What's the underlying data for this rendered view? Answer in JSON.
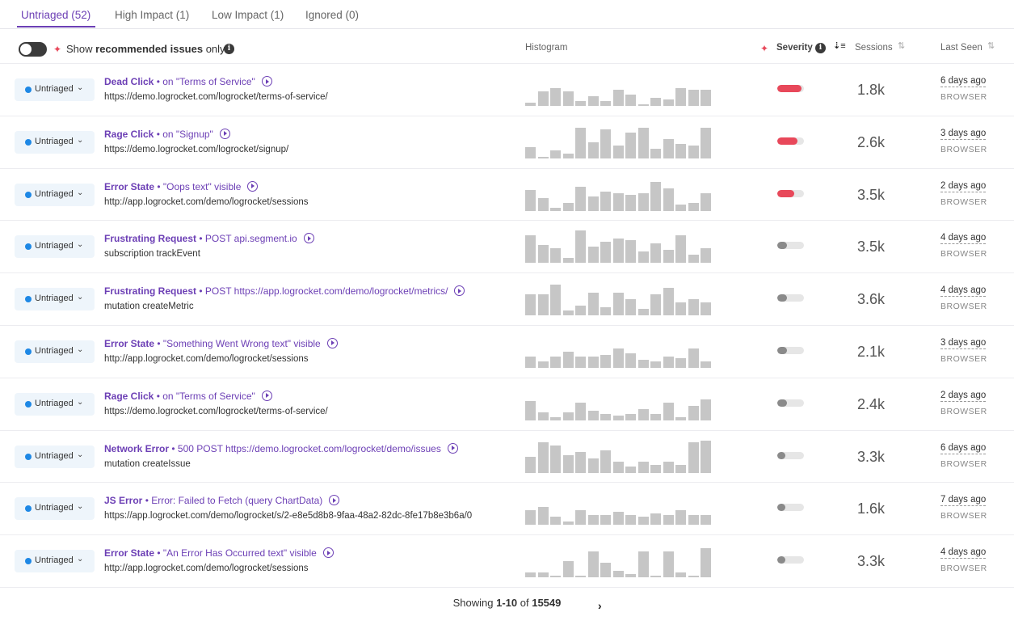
{
  "tabs": [
    {
      "label": "Untriaged (52)",
      "active": true
    },
    {
      "label": "High Impact (1)",
      "active": false
    },
    {
      "label": "Low Impact (1)",
      "active": false
    },
    {
      "label": "Ignored (0)",
      "active": false
    }
  ],
  "header": {
    "toggle_on": false,
    "rec_prefix": "Show ",
    "rec_bold": "recommended issues",
    "rec_suffix": " only",
    "info_glyph": "i",
    "col_histogram": "Histogram",
    "col_severity": "Severity",
    "col_sessions": "Sessions",
    "col_last_seen": "Last Seen"
  },
  "colors": {
    "accent": "#6c3fb5",
    "severity_high": "#e8485a",
    "severity_low": "#8a8a8a",
    "status_dot": "#1e88e5"
  },
  "rows": [
    {
      "status": "Untriaged",
      "type": "Dead Click",
      "detail": " • on \"Terms of Service\"",
      "sub": "https://demo.logrocket.com/logrocket/terms-of-service/",
      "histogram": [
        0.1,
        0.45,
        0.55,
        0.45,
        0.15,
        0.3,
        0.15,
        0.5,
        0.35,
        0.05,
        0.25,
        0.2,
        0.55,
        0.5,
        0.5
      ],
      "severity": 0.9,
      "severity_level": "high",
      "sessions": "1.8k",
      "last_seen": "6 days ago",
      "platform": "BROWSER"
    },
    {
      "status": "Untriaged",
      "type": "Rage Click",
      "detail": " • on \"Signup\"",
      "sub": "https://demo.logrocket.com/logrocket/signup/",
      "histogram": [
        0.35,
        0.05,
        0.25,
        0.15,
        0.95,
        0.5,
        0.9,
        0.4,
        0.8,
        0.95,
        0.3,
        0.6,
        0.45,
        0.4,
        0.95
      ],
      "severity": 0.75,
      "severity_level": "high",
      "sessions": "2.6k",
      "last_seen": "3 days ago",
      "platform": "BROWSER"
    },
    {
      "status": "Untriaged",
      "type": "Error State",
      "detail": " • \"Oops text\" visible",
      "sub": "http://app.logrocket.com/demo/logrocket/sessions",
      "histogram": [
        0.65,
        0.4,
        0.1,
        0.25,
        0.75,
        0.45,
        0.6,
        0.55,
        0.5,
        0.55,
        0.9,
        0.7,
        0.2,
        0.25,
        0.55
      ],
      "severity": 0.65,
      "severity_level": "high",
      "sessions": "3.5k",
      "last_seen": "2 days ago",
      "platform": "BROWSER"
    },
    {
      "status": "Untriaged",
      "type": "Frustrating Request",
      "detail": " • POST api.segment.io",
      "sub": "subscription trackEvent",
      "histogram": [
        0.85,
        0.55,
        0.45,
        0.15,
        1.0,
        0.5,
        0.65,
        0.75,
        0.7,
        0.35,
        0.6,
        0.4,
        0.85,
        0.25,
        0.45
      ],
      "severity": 0.35,
      "severity_level": "low",
      "sessions": "3.5k",
      "last_seen": "4 days ago",
      "platform": "BROWSER"
    },
    {
      "status": "Untriaged",
      "type": "Frustrating Request",
      "detail": " • POST https://app.logrocket.com/demo/logrocket/metrics/",
      "sub": "mutation createMetric",
      "histogram": [
        0.65,
        0.65,
        0.95,
        0.15,
        0.3,
        0.7,
        0.25,
        0.7,
        0.5,
        0.2,
        0.65,
        0.85,
        0.4,
        0.5,
        0.4
      ],
      "severity": 0.35,
      "severity_level": "low",
      "sessions": "3.6k",
      "last_seen": "4 days ago",
      "platform": "BROWSER"
    },
    {
      "status": "Untriaged",
      "type": "Error State",
      "detail": " • \"Something Went Wrong text\" visible",
      "sub": "http://app.logrocket.com/demo/logrocket/sessions",
      "histogram": [
        0.35,
        0.2,
        0.35,
        0.5,
        0.35,
        0.35,
        0.4,
        0.6,
        0.45,
        0.25,
        0.2,
        0.35,
        0.3,
        0.6,
        0.2
      ],
      "severity": 0.35,
      "severity_level": "low",
      "sessions": "2.1k",
      "last_seen": "3 days ago",
      "platform": "BROWSER"
    },
    {
      "status": "Untriaged",
      "type": "Rage Click",
      "detail": " • on \"Terms of Service\"",
      "sub": "https://demo.logrocket.com/logrocket/terms-of-service/",
      "histogram": [
        0.6,
        0.25,
        0.1,
        0.25,
        0.55,
        0.3,
        0.2,
        0.15,
        0.2,
        0.35,
        0.2,
        0.55,
        0.1,
        0.45,
        0.65
      ],
      "severity": 0.35,
      "severity_level": "low",
      "sessions": "2.4k",
      "last_seen": "2 days ago",
      "platform": "BROWSER"
    },
    {
      "status": "Untriaged",
      "type": "Network Error",
      "detail": " • 500 POST https://demo.logrocket.com/logrocket/demo/issues",
      "sub": "mutation createIssue",
      "histogram": [
        0.5,
        0.95,
        0.85,
        0.55,
        0.65,
        0.45,
        0.7,
        0.35,
        0.2,
        0.35,
        0.25,
        0.35,
        0.25,
        0.95,
        1.0
      ],
      "severity": 0.3,
      "severity_level": "low",
      "sessions": "3.3k",
      "last_seen": "6 days ago",
      "platform": "BROWSER"
    },
    {
      "status": "Untriaged",
      "type": "JS Error",
      "detail": " • Error: Failed to Fetch (query ChartData)",
      "sub": "https://app.logrocket.com/demo/logrocket/s/2-e8e5d8b8-9faa-48a2-82dc-8fe17b8e3b6a/0",
      "histogram": [
        0.45,
        0.55,
        0.25,
        0.1,
        0.45,
        0.3,
        0.3,
        0.4,
        0.3,
        0.25,
        0.35,
        0.3,
        0.45,
        0.3,
        0.3
      ],
      "severity": 0.3,
      "severity_level": "low",
      "sessions": "1.6k",
      "last_seen": "7 days ago",
      "platform": "BROWSER"
    },
    {
      "status": "Untriaged",
      "type": "Error State",
      "detail": " • \"An Error Has Occurred text\" visible",
      "sub": "http://app.logrocket.com/demo/logrocket/sessions",
      "histogram": [
        0.15,
        0.15,
        0.05,
        0.5,
        0.05,
        0.8,
        0.45,
        0.2,
        0.1,
        0.8,
        0.05,
        0.8,
        0.15,
        0.05,
        0.9
      ],
      "severity": 0.3,
      "severity_level": "low",
      "sessions": "3.3k",
      "last_seen": "4 days ago",
      "platform": "BROWSER"
    }
  ],
  "footer": {
    "prefix": "Showing ",
    "range": "1-10",
    "of": " of ",
    "total": "15549",
    "next_glyph": "›"
  }
}
